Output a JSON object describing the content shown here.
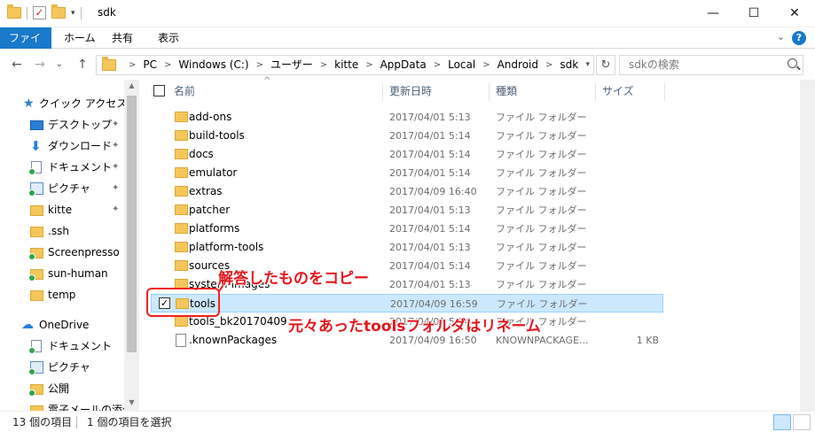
{
  "window": {
    "title": "sdk",
    "minimize_glyph": "—",
    "maximize_glyph": "☐",
    "close_glyph": "✕",
    "check_glyph": "✓"
  },
  "ribbon": {
    "tabs": [
      {
        "label": "ファイル",
        "active": true
      },
      {
        "label": "ホーム",
        "active": false
      },
      {
        "label": "共有",
        "active": false
      },
      {
        "label": "表示",
        "active": false
      }
    ],
    "expand_glyph": "⌄",
    "help_glyph": "?"
  },
  "nav": {
    "back_glyph": "←",
    "forward_glyph": "→",
    "recent_glyph": "⌄",
    "up_glyph": "↑",
    "breadcrumb": [
      "PC",
      "Windows (C:)",
      "ユーザー",
      "kitte",
      "AppData",
      "Local",
      "Android",
      "sdk"
    ],
    "crumb_separator": ">",
    "refresh_glyph": "↻",
    "search_placeholder": "sdkの検索"
  },
  "sidebar": {
    "items": [
      {
        "label": "クイック アクセス",
        "icon": "star-icon",
        "pinned": false
      },
      {
        "label": "デスクトップ",
        "icon": "desktop-icon",
        "pinned": true
      },
      {
        "label": "ダウンロード",
        "icon": "download-icon",
        "pinned": true
      },
      {
        "label": "ドキュメント",
        "icon": "documents-icon",
        "pinned": true
      },
      {
        "label": "ピクチャ",
        "icon": "pictures-icon",
        "pinned": true
      },
      {
        "label": "kitte",
        "icon": "folder-icon",
        "pinned": true
      },
      {
        "label": ".ssh",
        "icon": "folder-icon",
        "pinned": false
      },
      {
        "label": "Screenpresso",
        "icon": "folder-icon",
        "pinned": false
      },
      {
        "label": "sun-human",
        "icon": "folder-icon",
        "pinned": false
      },
      {
        "label": "temp",
        "icon": "folder-icon",
        "pinned": false
      },
      {
        "label": "OneDrive",
        "icon": "onedrive-icon",
        "pinned": false
      },
      {
        "label": "ドキュメント",
        "icon": "documents-icon",
        "pinned": false
      },
      {
        "label": "ピクチャ",
        "icon": "pictures-icon",
        "pinned": false
      },
      {
        "label": "公開",
        "icon": "folder-icon",
        "pinned": false
      },
      {
        "label": "電子メールの添付",
        "icon": "folder-icon",
        "pinned": false
      }
    ],
    "pin_glyph": "📌",
    "scroll_up_glyph": "▲",
    "scroll_down_glyph": "▼"
  },
  "columns": {
    "name": "名前",
    "date": "更新日時",
    "type": "種類",
    "size": "サイズ",
    "sort_glyph": "^"
  },
  "files": [
    {
      "name": "add-ons",
      "date": "2017/04/01 5:13",
      "type": "ファイル フォルダー",
      "size": "",
      "kind": "folder",
      "selected": false
    },
    {
      "name": "build-tools",
      "date": "2017/04/01 5:14",
      "type": "ファイル フォルダー",
      "size": "",
      "kind": "folder",
      "selected": false
    },
    {
      "name": "docs",
      "date": "2017/04/01 5:14",
      "type": "ファイル フォルダー",
      "size": "",
      "kind": "folder",
      "selected": false
    },
    {
      "name": "emulator",
      "date": "2017/04/01 5:14",
      "type": "ファイル フォルダー",
      "size": "",
      "kind": "folder",
      "selected": false
    },
    {
      "name": "extras",
      "date": "2017/04/09 16:40",
      "type": "ファイル フォルダー",
      "size": "",
      "kind": "folder",
      "selected": false
    },
    {
      "name": "patcher",
      "date": "2017/04/01 5:13",
      "type": "ファイル フォルダー",
      "size": "",
      "kind": "folder",
      "selected": false
    },
    {
      "name": "platforms",
      "date": "2017/04/01 5:14",
      "type": "ファイル フォルダー",
      "size": "",
      "kind": "folder",
      "selected": false
    },
    {
      "name": "platform-tools",
      "date": "2017/04/01 5:13",
      "type": "ファイル フォルダー",
      "size": "",
      "kind": "folder",
      "selected": false
    },
    {
      "name": "sources",
      "date": "2017/04/01 5:14",
      "type": "ファイル フォルダー",
      "size": "",
      "kind": "folder",
      "selected": false
    },
    {
      "name": "system-images",
      "date": "2017/04/01 5:13",
      "type": "ファイル フォルダー",
      "size": "",
      "kind": "folder",
      "selected": false
    },
    {
      "name": "tools",
      "date": "2017/04/09 16:59",
      "type": "ファイル フォルダー",
      "size": "",
      "kind": "folder",
      "selected": true
    },
    {
      "name": "tools_bk20170409",
      "date": "2017/04/01 5:14",
      "type": "ファイル フォルダー",
      "size": "",
      "kind": "folder",
      "selected": false
    },
    {
      "name": ".knownPackages",
      "date": "2017/04/09 16:50",
      "type": "KNOWNPACKAGE...",
      "size": "1 KB",
      "kind": "file",
      "selected": false
    }
  ],
  "annotations": {
    "copy_note": "解答したものをコピー",
    "rename_note": "元々あったtoolsフォルダはリネーム",
    "color": "#e2171d"
  },
  "status": {
    "item_count": "13 個の項目",
    "selected_count": "1 個の項目を選択"
  }
}
